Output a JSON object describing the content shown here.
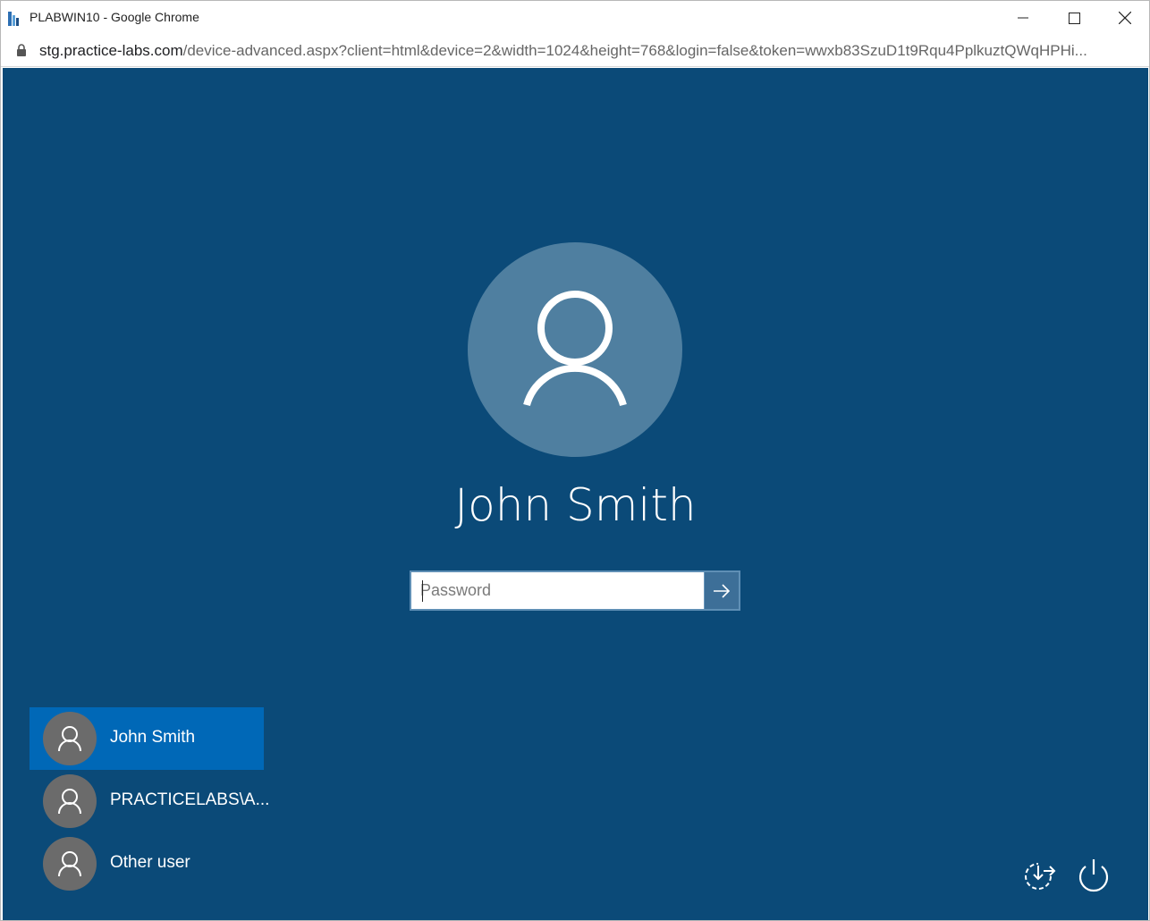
{
  "window": {
    "title": "PLABWIN10 - Google Chrome",
    "controls": {
      "minimize": "minimize-icon",
      "maximize": "maximize-icon",
      "close": "close-icon"
    }
  },
  "address_bar": {
    "host": "stg.practice-labs.com",
    "path": "/device-advanced.aspx?client=html&device=2&width=1024&height=768&login=false&token=wwxb83SzuD1t9Rqu4PplkuztQWqHPHi..."
  },
  "login": {
    "user_name": "John Smith",
    "password_placeholder": "Password",
    "password_value": "",
    "submit_icon": "arrow-right-icon"
  },
  "user_list": [
    {
      "label": "John Smith",
      "selected": true
    },
    {
      "label": "PRACTICELABS\\A...",
      "selected": false
    },
    {
      "label": "Other user",
      "selected": false
    }
  ],
  "bottom_icons": [
    "ease-of-access-icon",
    "power-icon"
  ],
  "colors": {
    "screen_background": "#0b4a78",
    "avatar_background": "#4f7fa0",
    "selected_user": "#0068b7",
    "submit_button": "#3d6f98"
  }
}
